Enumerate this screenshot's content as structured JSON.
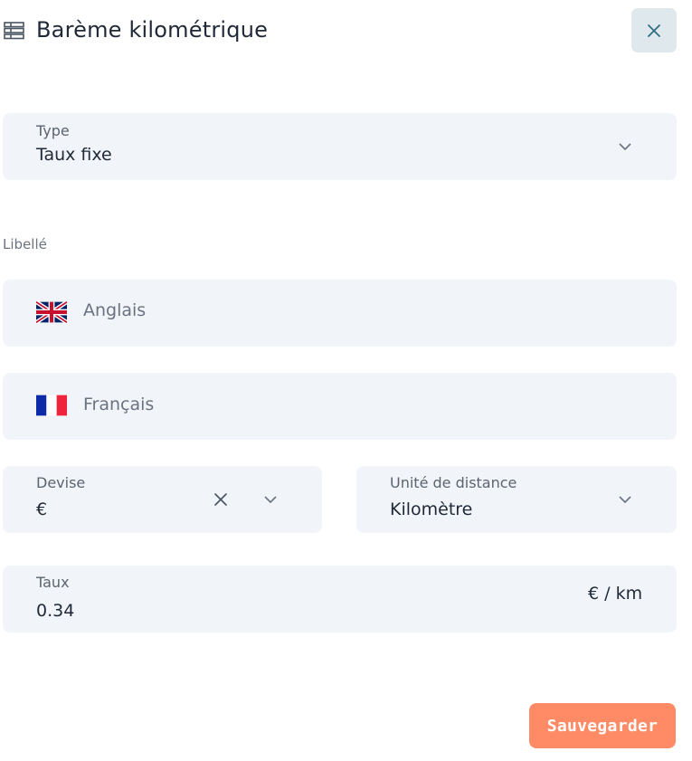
{
  "header": {
    "icon": "table-icon",
    "title": "Barème kilométrique",
    "close_icon": "close-icon"
  },
  "type_field": {
    "label": "Type",
    "value": "Taux fixe",
    "icon": "chevron-down-icon"
  },
  "libelle": {
    "label": "Libellé",
    "inputs": [
      {
        "flag": "uk-flag-icon",
        "placeholder": "Anglais"
      },
      {
        "flag": "france-flag-icon",
        "placeholder": "Français"
      }
    ]
  },
  "devise": {
    "label": "Devise",
    "value": "€",
    "clear_icon": "clear-icon",
    "icon": "chevron-down-icon"
  },
  "distance_unit": {
    "label": "Unité de distance",
    "value": "Kilomètre",
    "icon": "chevron-down-icon"
  },
  "taux": {
    "label": "Taux",
    "value": "0.34",
    "suffix": "€ / km"
  },
  "actions": {
    "save_label": "Sauvegarder"
  },
  "colors": {
    "field_bg": "#f1f4f8",
    "close_bg": "#dfe8ec",
    "save_bg": "#ff8b66",
    "text": "#1f2937",
    "muted": "#6b7280"
  }
}
